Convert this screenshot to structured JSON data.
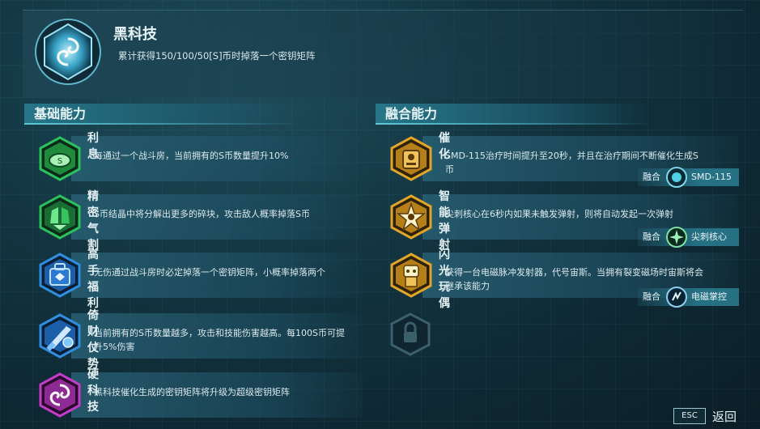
{
  "header": {
    "title": "黑科技",
    "description": "累计获得150/100/50[S]币时掉落一个密钥矩阵"
  },
  "basic": {
    "section_title": "基础能力",
    "items": [
      {
        "name": "利息",
        "desc": "每通过一个战斗房，当前拥有的S币数量提升10%",
        "icon": "green-coin-icon",
        "color": "#2ec05a"
      },
      {
        "name": "精密气割",
        "desc": "S币结晶中将分解出更多的碎块，攻击敌人概率掉落S币",
        "icon": "green-crystal-icon",
        "color": "#2ec05a"
      },
      {
        "name": "高手福利",
        "desc": "无伤通过战斗房时必定掉落一个密钥矩阵，小概率掉落两个",
        "icon": "blue-bag-icon",
        "color": "#2f8ee0"
      },
      {
        "name": "倚财仗势",
        "desc": "当前拥有的S币数量越多，攻击和技能伤害越高。每100S币可提升5%伤害",
        "icon": "blue-sword-icon",
        "color": "#2f8ee0"
      },
      {
        "name": "硬科技",
        "desc": "黑科技催化生成的密钥矩阵将升级为超级密钥矩阵",
        "icon": "purple-vortex-icon",
        "color": "#c23dc8"
      }
    ]
  },
  "fusion": {
    "section_title": "融合能力",
    "items": [
      {
        "name": "催化",
        "desc": "SMD-115治疗时间提升至20秒，并且在治疗期间不断催化生成S币",
        "icon": "gold-robot-icon",
        "fusion_label": "融合",
        "fusion_target": "SMD-115"
      },
      {
        "name": "智能弹射",
        "desc": "尖刺核心在6秒内如果未触发弹射，则将自动发起一次弹射",
        "icon": "gold-spike-icon",
        "fusion_label": "融合",
        "fusion_target": "尖刺核心"
      },
      {
        "name": "闪光玩偶",
        "desc": "获得一台电磁脉冲发射器，代号宙斯。当拥有裂变磁场时宙斯将会继承该能力",
        "icon": "gold-doll-icon",
        "fusion_label": "融合",
        "fusion_target": "电磁掌控"
      }
    ],
    "locked_icon": "lock-icon"
  },
  "footer": {
    "esc_key": "ESC",
    "back_label": "返回"
  },
  "colors": {
    "green": "#2ec05a",
    "blue": "#2f8ee0",
    "purple": "#c23dc8",
    "gold": "#e0a52a",
    "accent": "#5fc6d8"
  }
}
